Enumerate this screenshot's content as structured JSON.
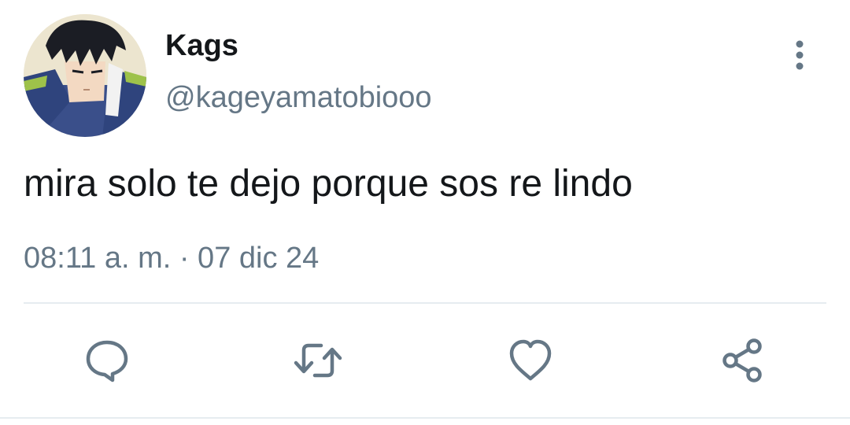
{
  "tweet": {
    "author": {
      "display_name": "Kags",
      "handle": "@kageyamatobiooo",
      "avatar_icon": "anime-avatar"
    },
    "text": "mira solo te dejo porque sos re lindo",
    "timestamp": "08:11 a. m. · 07 dic 24"
  },
  "header": {
    "more_icon": "vertical-dots-icon"
  },
  "actions": [
    {
      "name": "reply",
      "icon": "comment-icon"
    },
    {
      "name": "retweet",
      "icon": "retweet-icon"
    },
    {
      "name": "like",
      "icon": "heart-icon"
    },
    {
      "name": "share",
      "icon": "share-icon"
    }
  ],
  "colors": {
    "text_primary": "#14171a",
    "text_secondary": "#657786",
    "divider": "#e6ecf0"
  }
}
